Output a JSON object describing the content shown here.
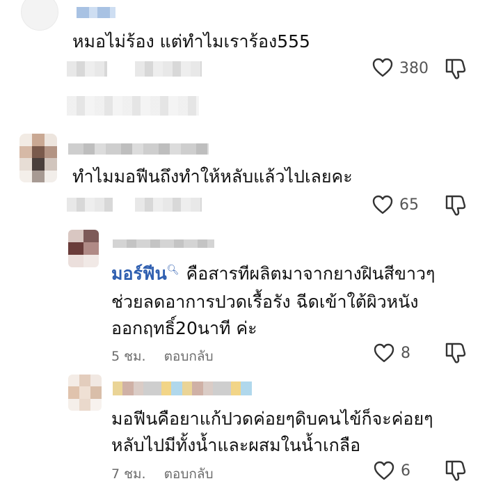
{
  "comments": [
    {
      "text": "หมอไม่ร้อง แต่ทำไมเราร้อง555",
      "likes": "380"
    },
    {
      "text": "ทำไมมอฟีนถึงทำให้หลับแล้วไปเลยคะ",
      "likes": "65"
    },
    {
      "mention": "มอร์ฟีน",
      "lines": [
        "คือสารทีผลิตมาจากยางฝินสีขาวๆ",
        "ช่วยลดอาการปวดเรื้อรัง ฉีดเข้าใต้ผิวหนัง",
        "ออกฤทธิ์20นาที ค่ะ"
      ],
      "time": "5 ชม.",
      "reply": "ตอบกลับ",
      "likes": "8"
    },
    {
      "lines": [
        "มอฟีนคือยาแก้ปวดค่อยๆดิบคนไข้ก็จะค่อยๆ",
        "หลับไปมีทั้งน้ำและผสมในน้ำเกลือ"
      ],
      "time": "7 ชม.",
      "reply": "ตอบกลับ",
      "likes": "6"
    }
  ],
  "icons": {
    "like": "heart-outline-icon",
    "dislike": "thumbs-down-outline-icon",
    "search": "search-icon"
  },
  "colors": {
    "mention": "#2f5fb0",
    "meta": "#6b6b6b",
    "icon": "#333333"
  }
}
